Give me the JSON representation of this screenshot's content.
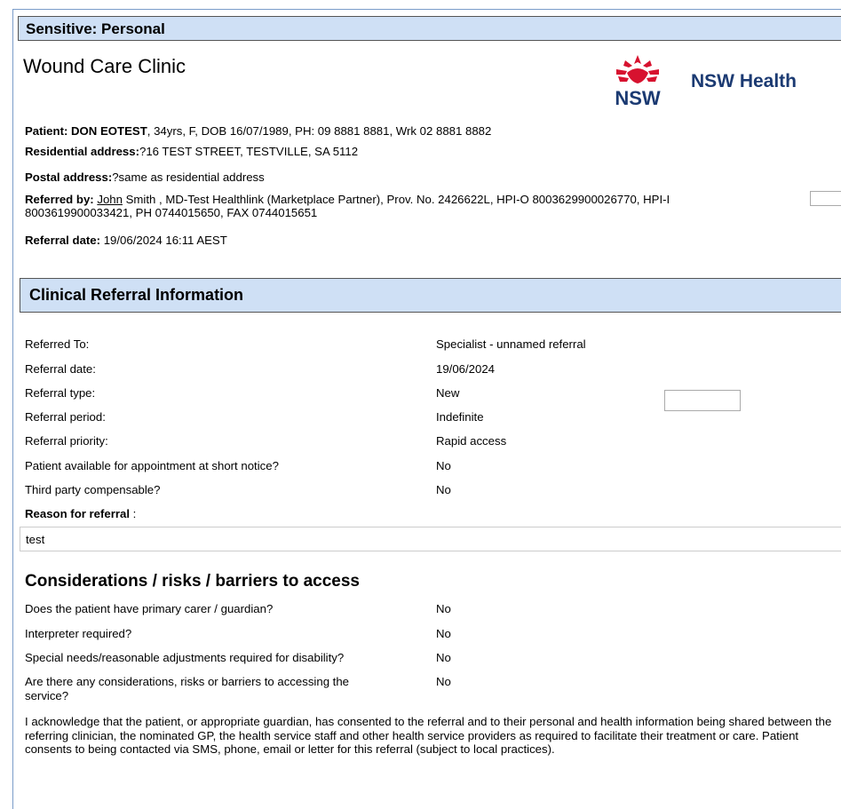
{
  "banner": {
    "label": "Sensitive: Personal"
  },
  "clinic": {
    "name": "Wound Care Clinic"
  },
  "logo": {
    "text": "NSW",
    "brand": "NSW Health",
    "color": "#d7122f",
    "brand_color": "#1b3a72"
  },
  "patient": {
    "label": "Patient: DON EOTEST",
    "details": ", 34yrs, F, DOB 16/07/1989, PH: 09 8881 8881, Wrk 02 8881 8882",
    "residential_label": "Residential address:",
    "residential_value": "?16 TEST STREET, TESTVILLE, SA 5112",
    "postal_label": "Postal address:",
    "postal_value": "?same as residential address"
  },
  "referrer": {
    "label": "Referred by:",
    "name": "John",
    "details_line1": " Smith , MD-Test Healthlink (Marketplace Partner), Prov. No. 2426622L, HPI-O 8003629900026770, HPI-I",
    "details_line2": "8003619900033421, PH 0744015650, FAX 0744015651"
  },
  "referral_date_header": {
    "label": "Referral date:",
    "value": " 19/06/2024 16:11 AEST"
  },
  "clinical": {
    "header": "Clinical Referral Information",
    "rows": [
      {
        "label": "Referred To:",
        "value": "Specialist - unnamed referral"
      },
      {
        "label": "Referral date:",
        "value": "19/06/2024"
      },
      {
        "label": "Referral type:",
        "value": "New"
      },
      {
        "label": "Referral period:",
        "value": "Indefinite"
      },
      {
        "label": "Referral priority:",
        "value": "Rapid access"
      },
      {
        "label": "Patient available for appointment at short notice?",
        "value": "No"
      },
      {
        "label": "Third party compensable?",
        "value": "No"
      }
    ],
    "reason_label": "Reason for referral",
    "reason_suffix": " :",
    "reason_value": "test"
  },
  "considerations": {
    "header": "Considerations / risks / barriers to access",
    "rows": [
      {
        "label": "Does the patient have primary carer / guardian?",
        "value": "No"
      },
      {
        "label": "Interpreter required?",
        "value": "No"
      },
      {
        "label": "Special needs/reasonable adjustments required for disability?",
        "value": "No"
      },
      {
        "label": "Are there any considerations, risks or barriers to accessing the",
        "label2": "service?",
        "value": "No"
      }
    ]
  },
  "consent": {
    "text": "I acknowledge that the patient, or appropriate guardian, has consented to the referral and to their personal and health information being shared between the referring clinician, the nominated GP, the health service staff and other health service providers as required to facilitate their treatment or care. Patient consents to being contacted via SMS, phone, email or letter for this referral (subject to local practices)."
  }
}
